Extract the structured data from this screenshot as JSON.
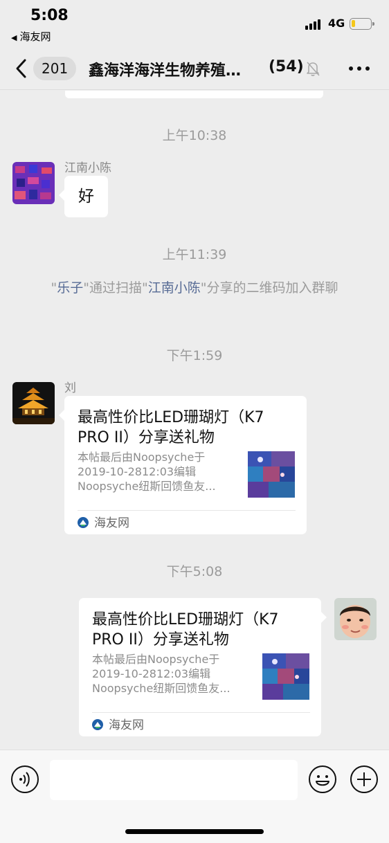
{
  "status_bar": {
    "time": "5:08",
    "back_app": "海友网",
    "network": "4G",
    "battery_level": 0.2,
    "battery_color": "#f5c71a"
  },
  "nav": {
    "unread_count": "201",
    "title": "鑫海洋海洋生物养殖交流群",
    "member_count": "(54)",
    "icons": [
      "chevron-left-icon",
      "muted-bell-icon",
      "more-icon"
    ]
  },
  "chat": {
    "messages": [
      {
        "type": "timestamp",
        "text": "上午10:38"
      },
      {
        "type": "text",
        "sender": "江南小陈",
        "text": "好"
      },
      {
        "type": "timestamp",
        "text": "上午11:39"
      },
      {
        "type": "system",
        "parts": [
          "\"",
          "乐子",
          "\"通过扫描\"",
          "江南小陈",
          "\"分享的二维码加入群聊"
        ]
      },
      {
        "type": "timestamp",
        "text": "下午1:59"
      },
      {
        "type": "link",
        "sender": "刘",
        "title": "最高性价比LED珊瑚灯（K7 PRO II）分享送礼物",
        "desc_lines": [
          "本帖最后由Noopsyche于",
          "2019-10-2812:03编辑",
          "Noopsyche纽斯回馈鱼友..."
        ],
        "source": "海友网"
      },
      {
        "type": "timestamp",
        "text": "下午5:08"
      },
      {
        "type": "link",
        "sender": "me",
        "title": "最高性价比LED珊瑚灯（K7 PRO II）分享送礼物",
        "desc_lines": [
          "本帖最后由Noopsyche于",
          "2019-10-2812:03编辑",
          "Noopsyche纽斯回馈鱼友..."
        ],
        "source": "海友网"
      }
    ]
  },
  "input_bar": {
    "placeholder": "",
    "icons": [
      "voice-icon",
      "emoji-icon",
      "plus-icon"
    ]
  },
  "colors": {
    "background": "#ededed",
    "link_name": "#576b95",
    "meta_text": "#9b9b9b"
  }
}
